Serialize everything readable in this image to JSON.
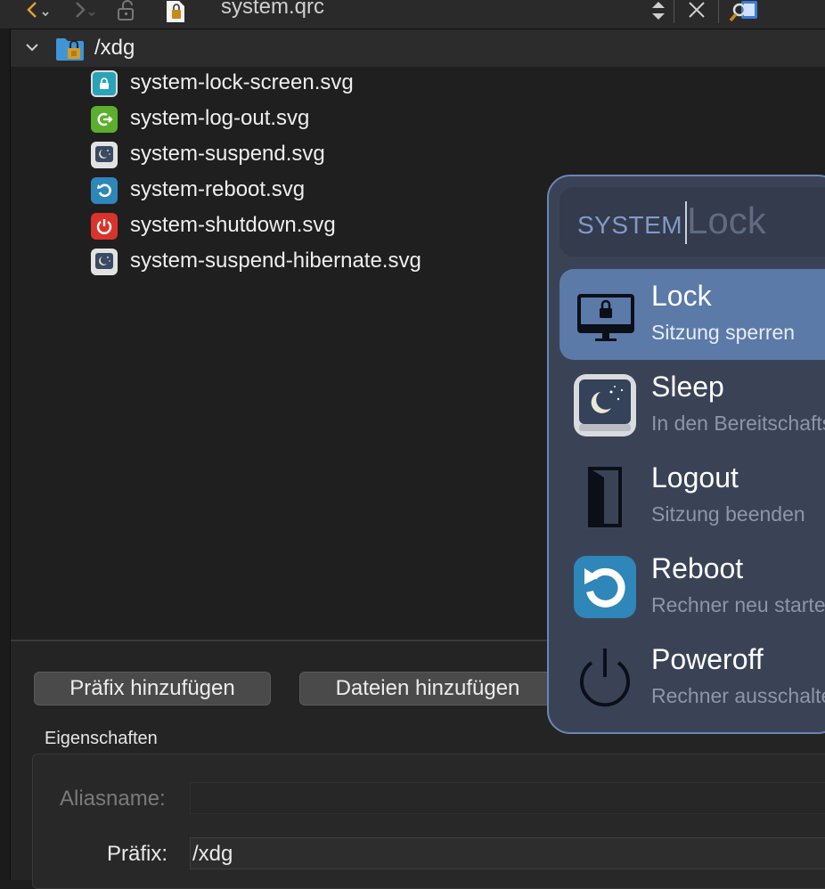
{
  "toolbar": {
    "file_title": "system.qrc"
  },
  "tree": {
    "root_label": "/xdg",
    "files": [
      {
        "name": "system-lock-screen.svg",
        "icon": "lock-screen-icon",
        "color": "#2aa3b8"
      },
      {
        "name": "system-log-out.svg",
        "icon": "log-out-icon",
        "color": "#5cae2e"
      },
      {
        "name": "system-suspend.svg",
        "icon": "suspend-icon",
        "color": "#4a5568"
      },
      {
        "name": "system-reboot.svg",
        "icon": "reboot-icon",
        "color": "#2f86b8"
      },
      {
        "name": "system-shutdown.svg",
        "icon": "shutdown-icon",
        "color": "#d8342c"
      },
      {
        "name": "system-suspend-hibernate.svg",
        "icon": "hibernate-icon",
        "color": "#4a5568"
      }
    ]
  },
  "buttons": {
    "add_prefix": "Präfix hinzufügen",
    "add_files": "Dateien hinzufügen"
  },
  "properties": {
    "section_title": "Eigenschaften",
    "alias_label": "Aliasname:",
    "alias_value": "",
    "prefix_label": "Präfix:",
    "prefix_value": "/xdg"
  },
  "launcher": {
    "search_prefix": "SYSTEM",
    "search_query": "Lock",
    "accent": "#5b7aa8",
    "items": [
      {
        "title": "Lock",
        "subtitle": "Sitzung sperren",
        "icon": "monitor-lock-icon",
        "selected": true
      },
      {
        "title": "Sleep",
        "subtitle": "In den Bereitschaftsmodus wechseln",
        "icon": "sleep-moon-icon",
        "selected": false
      },
      {
        "title": "Logout",
        "subtitle": "Sitzung beenden",
        "icon": "door-icon",
        "selected": false
      },
      {
        "title": "Reboot",
        "subtitle": "Rechner neu starten",
        "icon": "reboot-icon",
        "selected": false
      },
      {
        "title": "Poweroff",
        "subtitle": "Rechner ausschalten",
        "icon": "power-icon",
        "selected": false
      }
    ]
  }
}
